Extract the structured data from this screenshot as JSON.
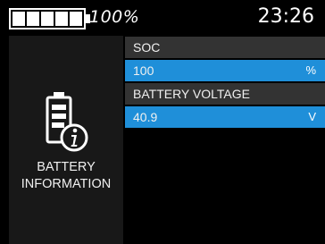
{
  "status": {
    "battery_percent": "100%",
    "battery_level": 1.0,
    "clock": "23:26"
  },
  "panel": {
    "title": "BATTERY\nINFORMATION",
    "icon": "battery-info-icon"
  },
  "fields": [
    {
      "label": "SOC",
      "value": "100",
      "unit": "%"
    },
    {
      "label": "BATTERY VOLTAGE",
      "value": "40.9",
      "unit": "V"
    }
  ],
  "colors": {
    "background": "#000000",
    "panel": "#181818",
    "label_row": "#333333",
    "value_row": "#1f8fd9",
    "text": "#ffffff"
  }
}
